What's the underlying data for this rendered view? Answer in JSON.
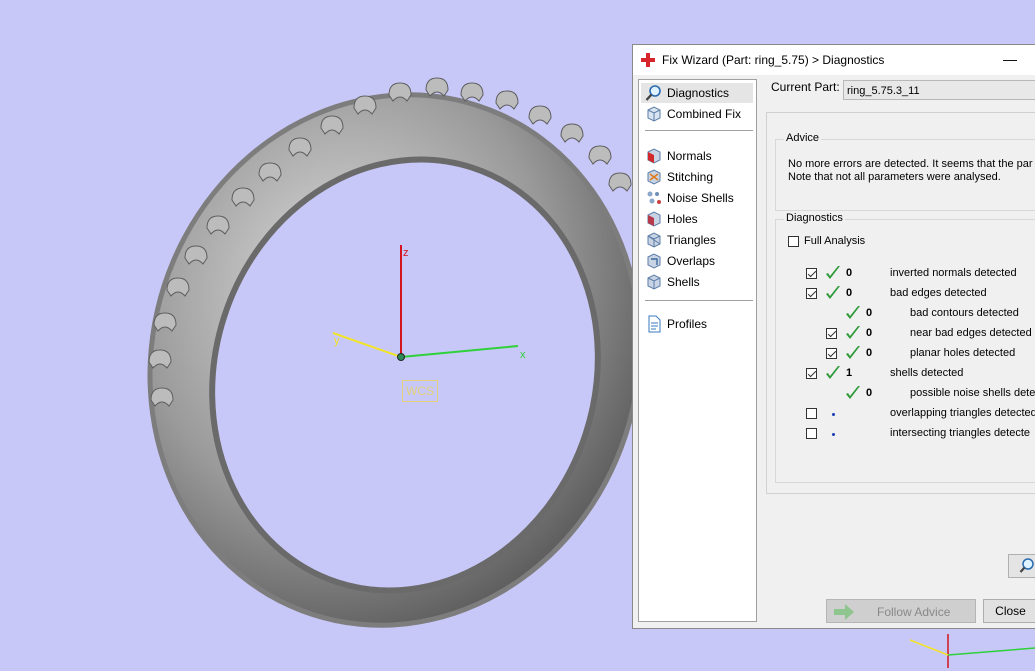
{
  "viewport": {
    "axis_labels": {
      "z": "z",
      "y": "y",
      "x": "x"
    },
    "wcs": "WCS",
    "colors": {
      "background": "#c8c8f8",
      "ring": "#8e8e8e",
      "z_axis": "#d4141e",
      "x_axis": "#2fd13a",
      "y_axis": "#f2e428"
    }
  },
  "dialog": {
    "title": "Fix Wizard (Part: ring_5.75) > Diagnostics",
    "minimize_glyph": "—",
    "sidebar": {
      "top_items": [
        {
          "label": "Diagnostics",
          "icon": "magnifier-icon",
          "selected": true
        },
        {
          "label": "Combined Fix",
          "icon": "cube-icon"
        }
      ],
      "fix_items": [
        {
          "label": "Normals",
          "icon": "normals-cube-icon"
        },
        {
          "label": "Stitching",
          "icon": "stitching-cube-icon"
        },
        {
          "label": "Noise Shells",
          "icon": "noise-shells-icon"
        },
        {
          "label": "Holes",
          "icon": "holes-cube-icon"
        },
        {
          "label": "Triangles",
          "icon": "triangles-cube-icon"
        },
        {
          "label": "Overlaps",
          "icon": "overlaps-cube-icon"
        },
        {
          "label": "Shells",
          "icon": "shells-cube-icon"
        }
      ],
      "bottom_items": [
        {
          "label": "Profiles",
          "icon": "document-icon"
        }
      ]
    },
    "current_part_label": "Current Part:",
    "current_part_value": "ring_5.75.3_11",
    "advice_title": "Advice",
    "advice_line1": "No more errors are detected. It seems that the par",
    "advice_line2": "Note that not all parameters were analysed.",
    "diagnostics_title": "Diagnostics",
    "full_analysis_label": "Full Analysis",
    "full_analysis_checked": false,
    "rows": [
      {
        "label": "inverted normals detected",
        "count": "0",
        "checked": true,
        "status": "ok",
        "indent": 0
      },
      {
        "label": "bad edges detected",
        "count": "0",
        "checked": true,
        "status": "ok",
        "indent": 0
      },
      {
        "label": "bad contours detected",
        "count": "0",
        "checked": null,
        "status": "ok",
        "indent": 1
      },
      {
        "label": "near bad edges detected",
        "count": "0",
        "checked": true,
        "status": "ok",
        "indent": 1
      },
      {
        "label": "planar holes detected",
        "count": "0",
        "checked": true,
        "status": "ok",
        "indent": 1
      },
      {
        "label": "shells detected",
        "count": "1",
        "checked": true,
        "status": "ok",
        "indent": 0
      },
      {
        "label": "possible noise shells detec",
        "count": "0",
        "checked": null,
        "status": "ok",
        "indent": 1
      },
      {
        "label": "overlapping triangles detected",
        "count": "",
        "checked": false,
        "status": "pending",
        "indent": 0
      },
      {
        "label": "intersecting triangles detecte",
        "count": "",
        "checked": false,
        "status": "pending",
        "indent": 0
      }
    ],
    "follow_advice_label": "Follow Advice",
    "close_label": "Close"
  }
}
